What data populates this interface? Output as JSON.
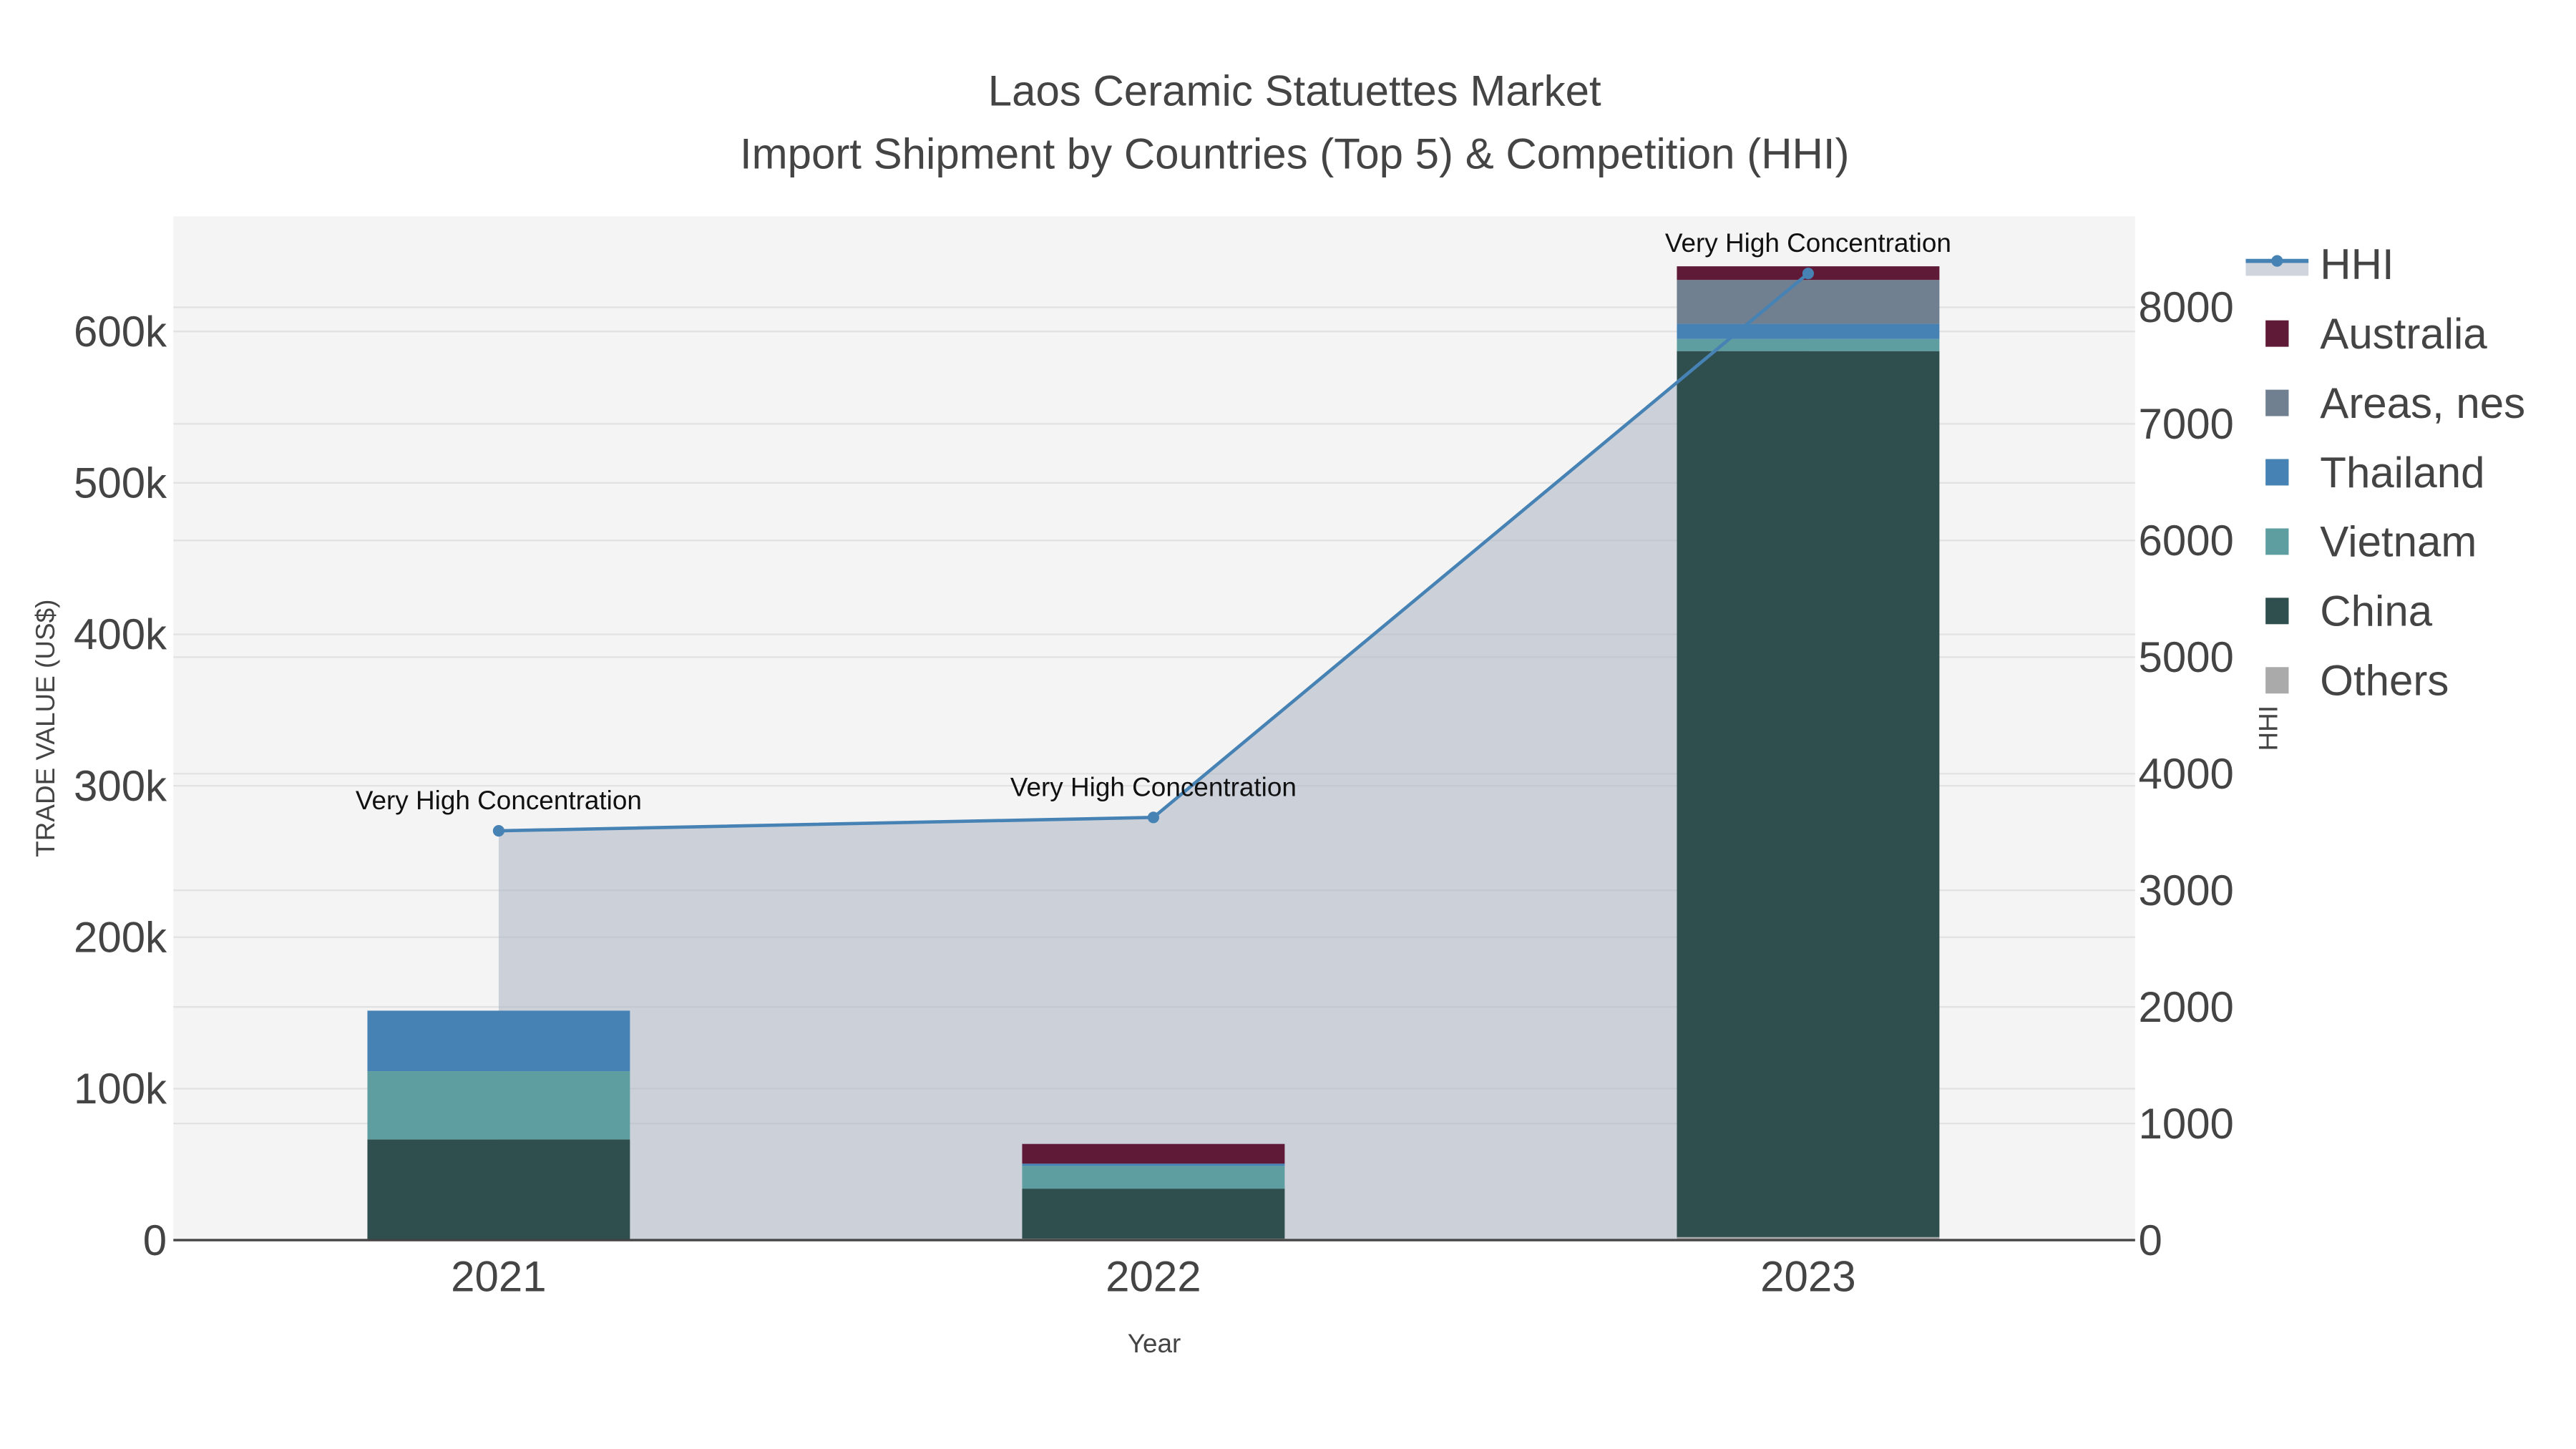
{
  "chart_data": {
    "type": "bar",
    "title": "Laos Ceramic Statuettes Market",
    "subtitle": "Import Shipment by Countries (Top 5) & Competition (HHI)",
    "xlabel": "Year",
    "ylabel": "TRADE VALUE (US$)",
    "y2label": "HHI",
    "categories": [
      "2021",
      "2022",
      "2023"
    ],
    "ylim": [
      0,
      676000
    ],
    "y2lim": [
      0,
      8780
    ],
    "yticks": [
      0,
      100000,
      200000,
      300000,
      400000,
      500000,
      600000
    ],
    "ytick_labels": [
      "0",
      "100k",
      "200k",
      "300k",
      "400k",
      "500k",
      "600k"
    ],
    "y2ticks": [
      0,
      1000,
      2000,
      3000,
      4000,
      5000,
      6000,
      7000,
      8000
    ],
    "y2tick_labels": [
      "0",
      "1000",
      "2000",
      "3000",
      "4000",
      "5000",
      "6000",
      "7000",
      "8000"
    ],
    "grid": true,
    "legend_position": "right",
    "series": [
      {
        "name": "Others",
        "color": "#aaaaaa",
        "values": [
          0,
          1000,
          2000
        ]
      },
      {
        "name": "China",
        "color": "#2f4f4f",
        "values": [
          66500,
          33000,
          585000
        ]
      },
      {
        "name": "Vietnam",
        "color": "#5f9ea0",
        "values": [
          45000,
          15000,
          8000
        ]
      },
      {
        "name": "Thailand",
        "color": "#4682b4",
        "values": [
          40000,
          1500,
          10000
        ]
      },
      {
        "name": "Areas, nes",
        "color": "#708090",
        "values": [
          0,
          0,
          29000
        ]
      },
      {
        "name": "Australia",
        "color": "#5f1a37",
        "values": [
          0,
          13000,
          9000
        ]
      }
    ],
    "hhi": {
      "name": "HHI",
      "color": "#4682b4",
      "values": [
        3510,
        3625,
        8290
      ]
    },
    "annotations": [
      "Very High Concentration",
      "Very High Concentration",
      "Very High Concentration"
    ],
    "legend_order": [
      "HHI",
      "Australia",
      "Areas, nes",
      "Thailand",
      "Vietnam",
      "China",
      "Others"
    ]
  }
}
